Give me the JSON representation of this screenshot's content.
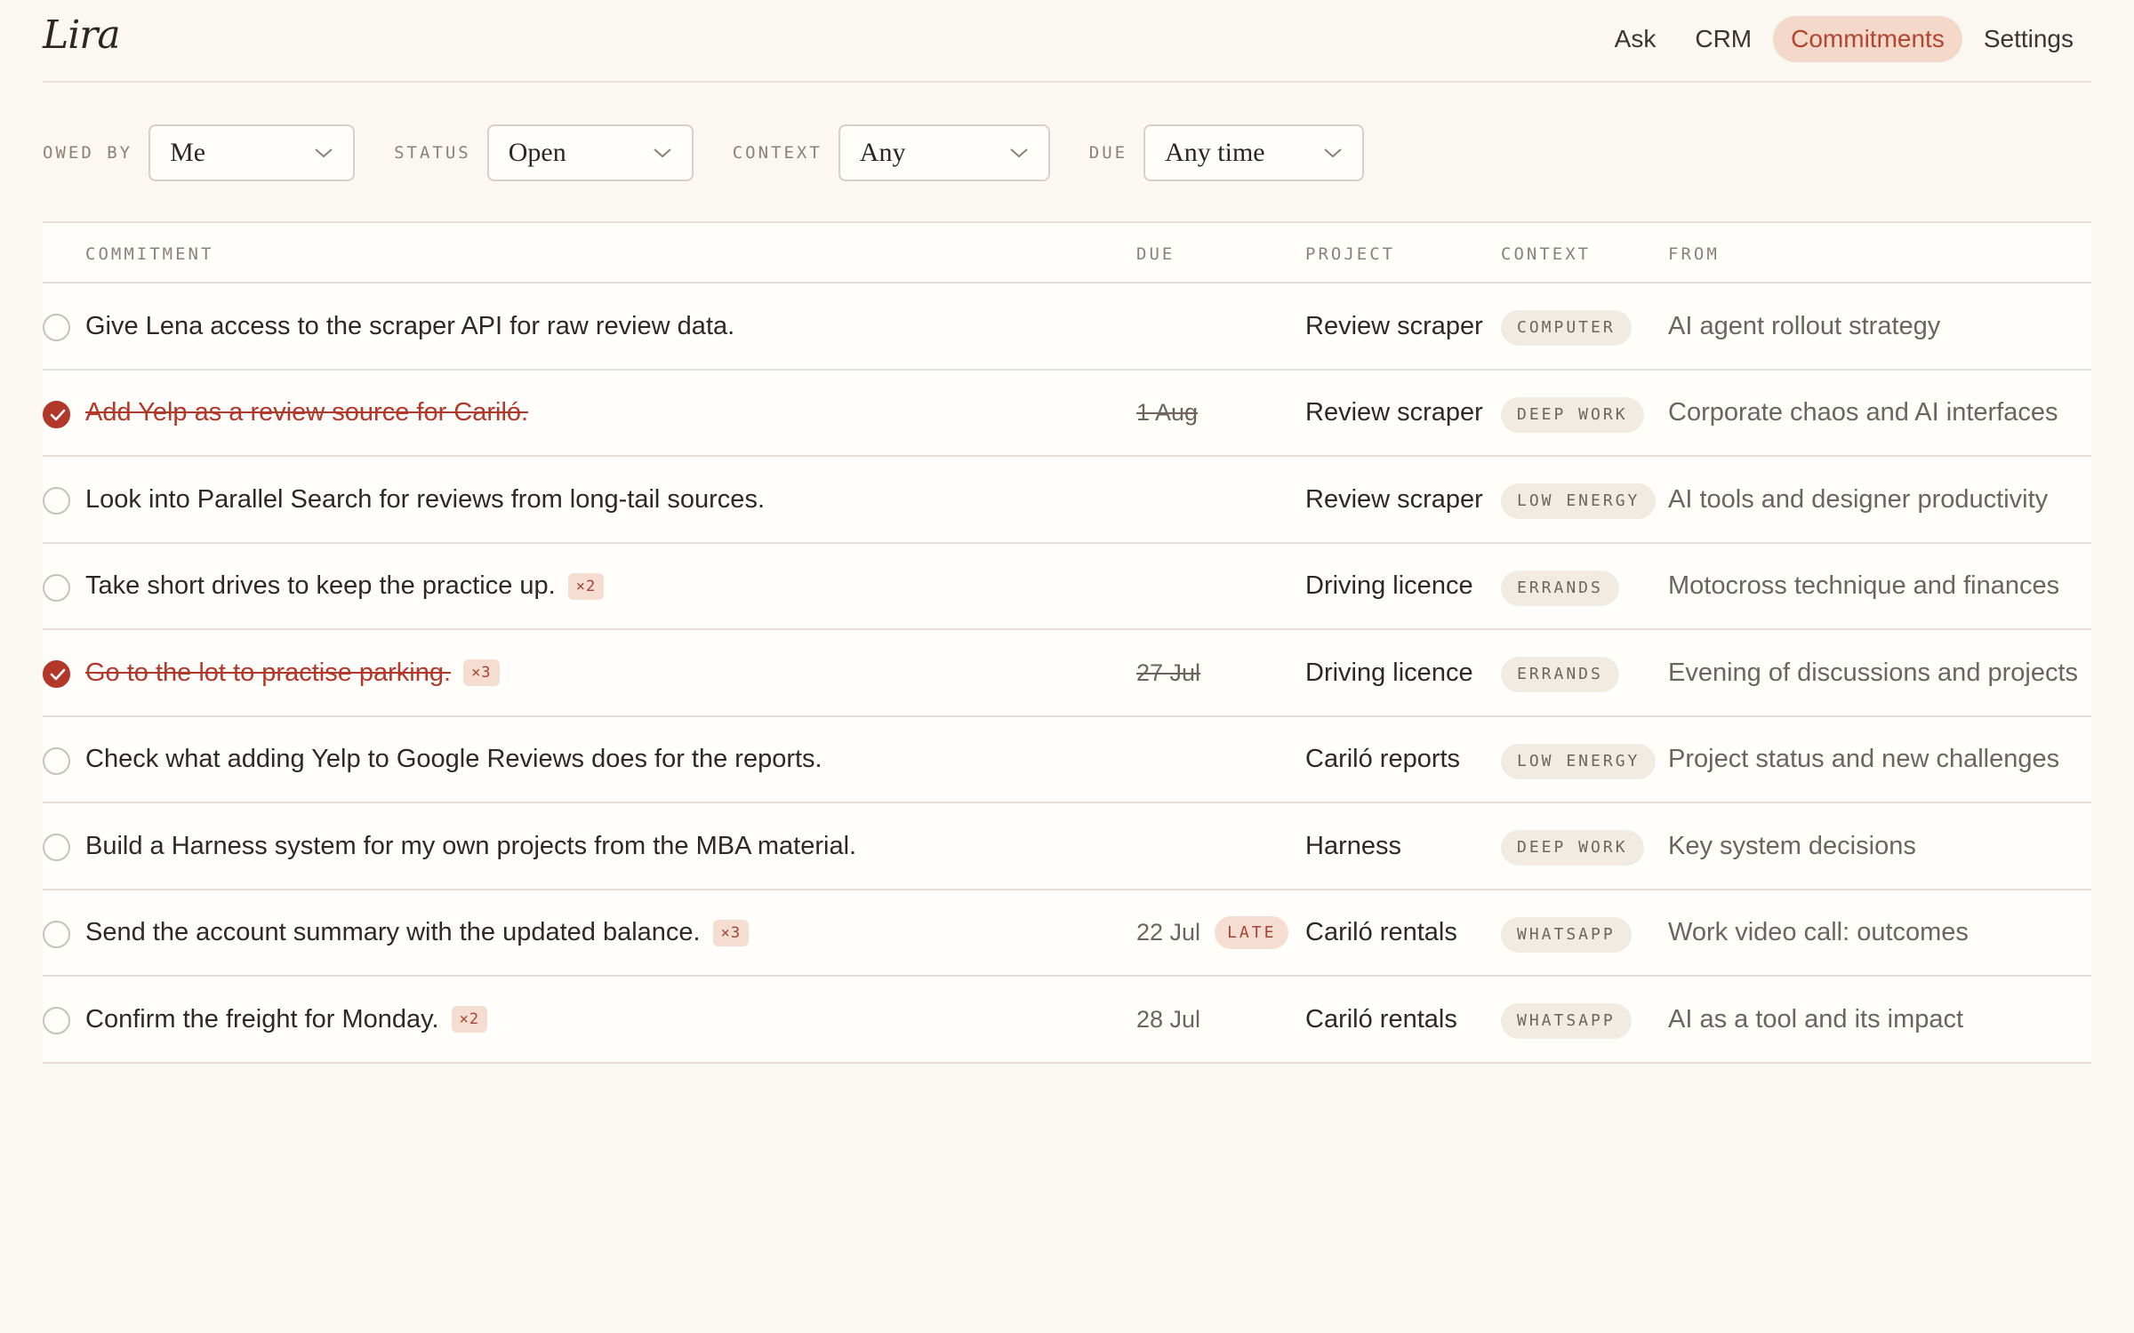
{
  "app": {
    "logo": "Lira"
  },
  "nav": [
    {
      "label": "Ask"
    },
    {
      "label": "CRM"
    },
    {
      "label": "Commitments",
      "active": true
    },
    {
      "label": "Settings"
    }
  ],
  "filters": {
    "owed_by": {
      "label": "OWED BY",
      "value": "Me"
    },
    "status": {
      "label": "STATUS",
      "value": "Open"
    },
    "context": {
      "label": "CONTEXT",
      "value": "Any"
    },
    "due": {
      "label": "DUE",
      "value": "Any time"
    }
  },
  "table": {
    "headers": {
      "commitment": "COMMITMENT",
      "due": "DUE",
      "project": "PROJECT",
      "context": "CONTEXT",
      "from": "FROM"
    },
    "rows": [
      {
        "done": false,
        "title": "Give Lena access to the scraper API for raw review data.",
        "count": "",
        "due": "",
        "late": "",
        "project": "Review scraper",
        "context": "COMPUTER",
        "from": "AI agent rollout strategy"
      },
      {
        "done": true,
        "title": "Add Yelp as a review source for Cariló.",
        "count": "",
        "due": "1 Aug",
        "late": "",
        "project": "Review scraper",
        "context": "DEEP WORK",
        "from": "Corporate chaos and AI interfaces"
      },
      {
        "done": false,
        "title": "Look into Parallel Search for reviews from long-tail sources.",
        "count": "",
        "due": "",
        "late": "",
        "project": "Review scraper",
        "context": "LOW ENERGY",
        "from": "AI tools and designer productivity"
      },
      {
        "done": false,
        "title": "Take short drives to keep the practice up.",
        "count": "×2",
        "due": "",
        "late": "",
        "project": "Driving licence",
        "context": "ERRANDS",
        "from": "Motocross technique and finances"
      },
      {
        "done": true,
        "title": "Go to the lot to practise parking.",
        "count": "×3",
        "due": "27 Jul",
        "late": "",
        "project": "Driving licence",
        "context": "ERRANDS",
        "from": "Evening of discussions and projects"
      },
      {
        "done": false,
        "title": "Check what adding Yelp to Google Reviews does for the reports.",
        "count": "",
        "due": "",
        "late": "",
        "project": "Cariló reports",
        "context": "LOW ENERGY",
        "from": "Project status and new challenges"
      },
      {
        "done": false,
        "title": "Build a Harness system for my own projects from the MBA material.",
        "count": "",
        "due": "",
        "late": "",
        "project": "Harness",
        "context": "DEEP WORK",
        "from": "Key system decisions"
      },
      {
        "done": false,
        "title": "Send the account summary with the updated balance.",
        "count": "×3",
        "due": "22 Jul",
        "late": "LATE",
        "project": "Cariló rentals",
        "context": "WHATSAPP",
        "from": "Work video call: outcomes"
      },
      {
        "done": false,
        "title": "Confirm the freight for Monday.",
        "count": "×2",
        "due": "28 Jul",
        "late": "",
        "project": "Cariló rentals",
        "context": "WHATSAPP",
        "from": "AI as a tool and its impact"
      }
    ]
  },
  "colors": {
    "accent": "#b2382a",
    "background": "#fbf7f1",
    "nav_active_bg": "#f4d9cb"
  }
}
